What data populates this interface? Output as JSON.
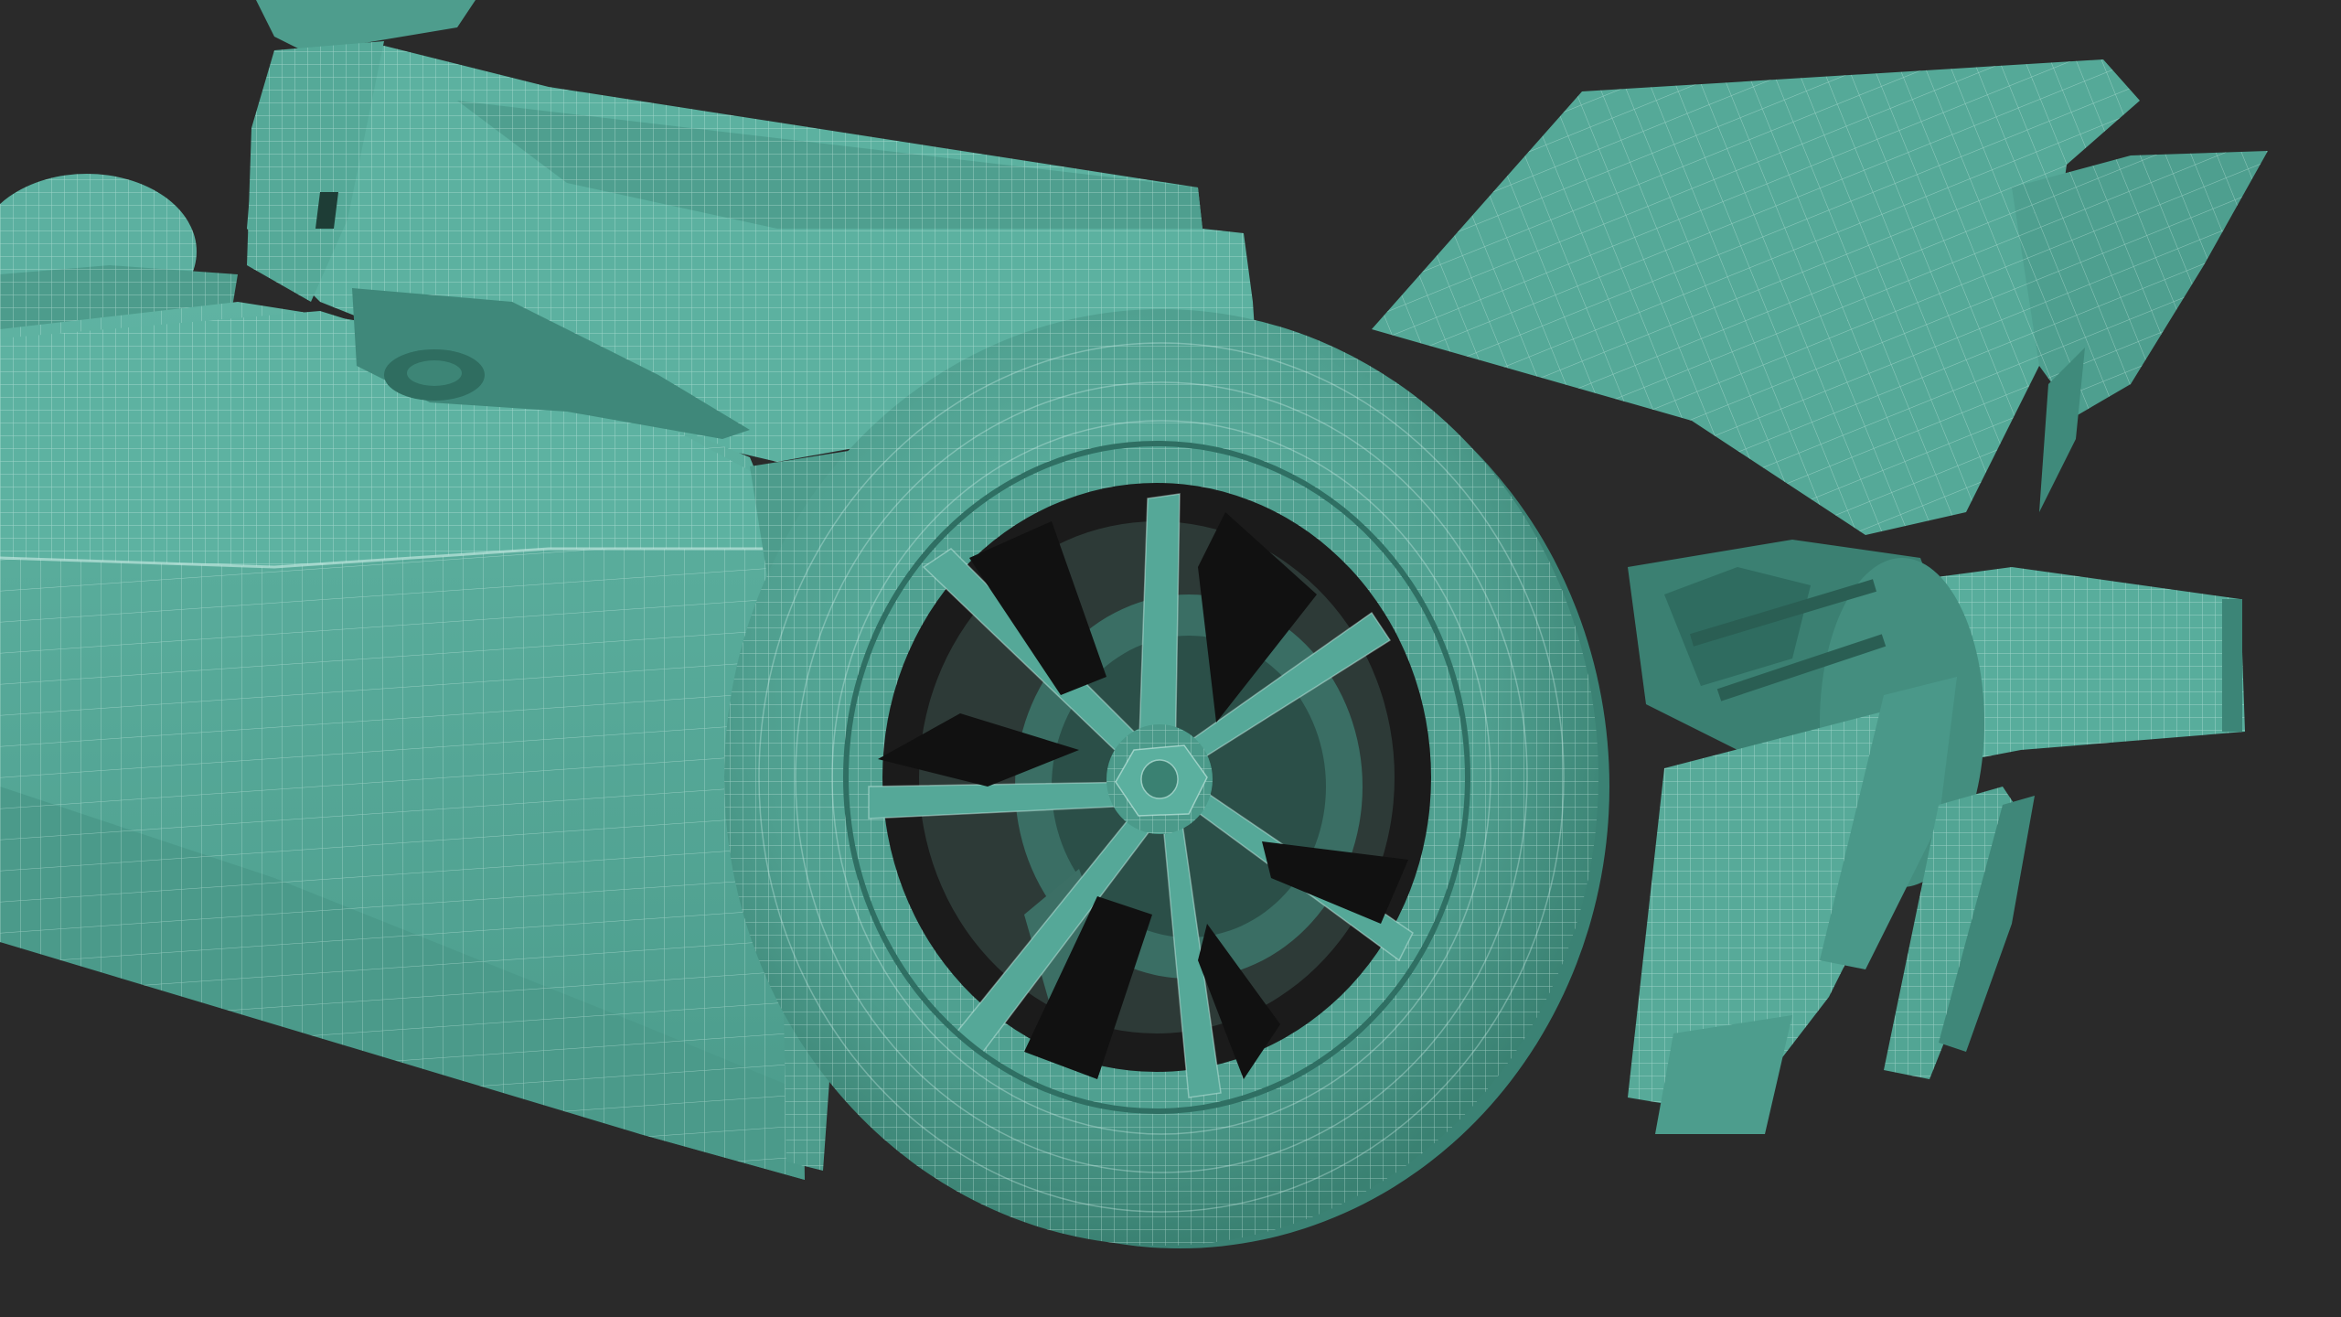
{
  "scene": {
    "colors": {
      "background": "#2a2a2a",
      "model_light": "#5fb3a2",
      "model_mid": "#4a9a8a",
      "model_dark": "#2f6f63",
      "wireframe": "#cfeee7",
      "cavity": "#121212"
    }
  }
}
